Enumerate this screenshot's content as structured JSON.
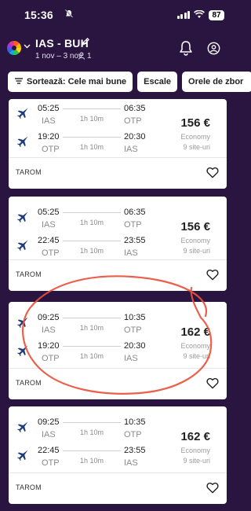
{
  "status": {
    "time": "15:36",
    "battery": "87"
  },
  "header": {
    "route": "IAS - BUH",
    "dates": "1 nov – 3 nov",
    "passengers": "1"
  },
  "filters": [
    {
      "label": "Sortează: Cele mai bune"
    },
    {
      "label": "Escale"
    },
    {
      "label": "Orele de zbor"
    }
  ],
  "results": [
    {
      "outbound": {
        "dep_time": "05:25",
        "dep_airport": "IAS",
        "duration": "1h 10m",
        "arr_time": "06:35",
        "arr_airport": "OTP"
      },
      "inbound": {
        "dep_time": "19:20",
        "dep_airport": "OTP",
        "duration": "1h 10m",
        "arr_time": "20:30",
        "arr_airport": "IAS"
      },
      "price": "156 €",
      "cabin": "Economy",
      "sites": "9 site-uri",
      "airline": "TAROM"
    },
    {
      "outbound": {
        "dep_time": "05:25",
        "dep_airport": "IAS",
        "duration": "1h 10m",
        "arr_time": "06:35",
        "arr_airport": "OTP"
      },
      "inbound": {
        "dep_time": "22:45",
        "dep_airport": "OTP",
        "duration": "1h 10m",
        "arr_time": "23:55",
        "arr_airport": "IAS"
      },
      "price": "156 €",
      "cabin": "Economy",
      "sites": "9 site-uri",
      "airline": "TAROM"
    },
    {
      "outbound": {
        "dep_time": "09:25",
        "dep_airport": "IAS",
        "duration": "1h 10m",
        "arr_time": "10:35",
        "arr_airport": "OTP"
      },
      "inbound": {
        "dep_time": "19:20",
        "dep_airport": "OTP",
        "duration": "1h 10m",
        "arr_time": "20:30",
        "arr_airport": "IAS"
      },
      "price": "162 €",
      "cabin": "Economy",
      "sites": "9 site-uri",
      "airline": "TAROM"
    },
    {
      "outbound": {
        "dep_time": "09:25",
        "dep_airport": "IAS",
        "duration": "1h 10m",
        "arr_time": "10:35",
        "arr_airport": "OTP"
      },
      "inbound": {
        "dep_time": "22:45",
        "dep_airport": "OTP",
        "duration": "1h 10m",
        "arr_time": "23:55",
        "arr_airport": "IAS"
      },
      "price": "162 €",
      "cabin": "Economy",
      "sites": "9 site-uri",
      "airline": "TAROM"
    }
  ],
  "colors": {
    "background": "#2a1540",
    "annotation": "#e8523c",
    "airline_logo": "#1d3c78"
  }
}
